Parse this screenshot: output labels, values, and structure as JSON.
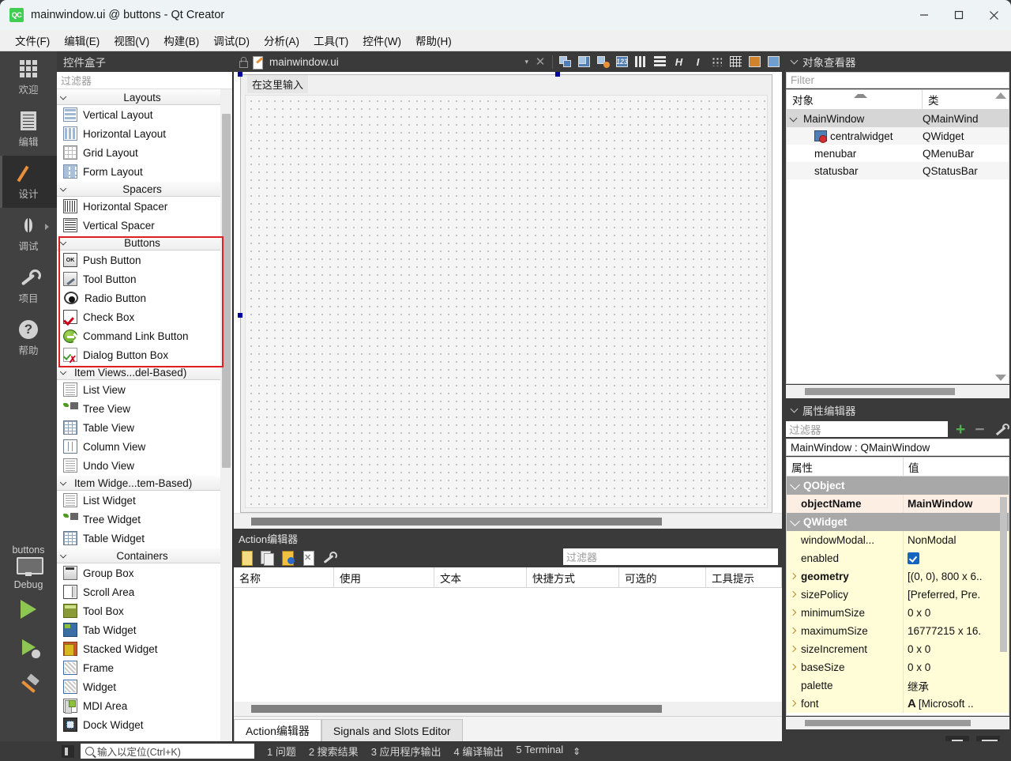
{
  "titlebar": {
    "icon": "qt-logo-icon",
    "title": "mainwindow.ui @ buttons - Qt Creator",
    "minimize": "—",
    "maximize": "□",
    "close": "✕"
  },
  "menubar": {
    "items": [
      "文件(F)",
      "编辑(E)",
      "视图(V)",
      "构建(B)",
      "调试(D)",
      "分析(A)",
      "工具(T)",
      "控件(W)",
      "帮助(H)"
    ]
  },
  "modebar": {
    "modes": [
      {
        "label": "欢迎",
        "icon": "grid-icon",
        "active": false
      },
      {
        "label": "编辑",
        "icon": "document-icon",
        "active": false
      },
      {
        "label": "设计",
        "icon": "pencil-icon",
        "active": true
      },
      {
        "label": "调试",
        "icon": "bug-icon",
        "active": false
      },
      {
        "label": "项目",
        "icon": "wrench-icon",
        "active": false
      },
      {
        "label": "帮助",
        "icon": "question-icon",
        "active": false
      }
    ],
    "kit_name": "buttons",
    "kit_config": "Debug",
    "run_label": "run-button",
    "debug_label": "start-debugging-button",
    "build_label": "build-button"
  },
  "widgetbox": {
    "header": "控件盒子",
    "filter_placeholder": "过滤器",
    "groups": [
      {
        "title": "Layouts",
        "centered": true,
        "highlighted": false,
        "items": [
          {
            "label": "Vertical Layout",
            "icon": "vertical-layout-icon",
            "cls": "ic-vlayout"
          },
          {
            "label": "Horizontal Layout",
            "icon": "horizontal-layout-icon",
            "cls": "ic-hlayout"
          },
          {
            "label": "Grid Layout",
            "icon": "grid-layout-icon",
            "cls": "ic-grid"
          },
          {
            "label": "Form Layout",
            "icon": "form-layout-icon",
            "cls": "ic-form"
          }
        ]
      },
      {
        "title": "Spacers",
        "centered": true,
        "highlighted": false,
        "items": [
          {
            "label": "Horizontal Spacer",
            "icon": "horizontal-spacer-icon",
            "cls": "ic-hspacer"
          },
          {
            "label": "Vertical Spacer",
            "icon": "vertical-spacer-icon",
            "cls": "ic-vspacer"
          }
        ]
      },
      {
        "title": "Buttons",
        "centered": true,
        "highlighted": true,
        "items": [
          {
            "label": "Push Button",
            "icon": "push-button-icon",
            "cls": "ic-push",
            "text": "OK"
          },
          {
            "label": "Tool Button",
            "icon": "tool-button-icon",
            "cls": "ic-tool"
          },
          {
            "label": "Radio Button",
            "icon": "radio-button-icon",
            "cls": "ic-radio"
          },
          {
            "label": "Check Box",
            "icon": "check-box-icon",
            "cls": "ic-check"
          },
          {
            "label": "Command Link Button",
            "icon": "command-link-button-icon",
            "cls": "ic-cmd"
          },
          {
            "label": "Dialog Button Box",
            "icon": "dialog-button-box-icon",
            "cls": "ic-dlg"
          }
        ]
      },
      {
        "title": "Item Views...del-Based)",
        "centered": false,
        "highlighted": false,
        "items": [
          {
            "label": "List View",
            "icon": "list-view-icon",
            "cls": "ic-listv"
          },
          {
            "label": "Tree View",
            "icon": "tree-view-icon",
            "cls": "ic-treev"
          },
          {
            "label": "Table View",
            "icon": "table-view-icon",
            "cls": "ic-tablev"
          },
          {
            "label": "Column View",
            "icon": "column-view-icon",
            "cls": "ic-colv"
          },
          {
            "label": "Undo View",
            "icon": "undo-view-icon",
            "cls": "ic-listv"
          }
        ]
      },
      {
        "title": "Item Widge...tem-Based)",
        "centered": false,
        "highlighted": false,
        "items": [
          {
            "label": "List Widget",
            "icon": "list-widget-icon",
            "cls": "ic-listv"
          },
          {
            "label": "Tree Widget",
            "icon": "tree-widget-icon",
            "cls": "ic-treev"
          },
          {
            "label": "Table Widget",
            "icon": "table-widget-icon",
            "cls": "ic-tablev"
          }
        ]
      },
      {
        "title": "Containers",
        "centered": true,
        "highlighted": false,
        "items": [
          {
            "label": "Group Box",
            "icon": "group-box-icon",
            "cls": "ic-group"
          },
          {
            "label": "Scroll Area",
            "icon": "scroll-area-icon",
            "cls": "ic-scroll"
          },
          {
            "label": "Tool Box",
            "icon": "tool-box-icon",
            "cls": "ic-toolbox"
          },
          {
            "label": "Tab Widget",
            "icon": "tab-widget-icon",
            "cls": "ic-tab"
          },
          {
            "label": "Stacked Widget",
            "icon": "stacked-widget-icon",
            "cls": "ic-stacked"
          },
          {
            "label": "Frame",
            "icon": "frame-icon",
            "cls": "ic-frame"
          },
          {
            "label": "Widget",
            "icon": "widget-icon",
            "cls": "ic-frame"
          },
          {
            "label": "MDI Area",
            "icon": "mdi-area-icon",
            "cls": "ic-mdi"
          },
          {
            "label": "Dock Widget",
            "icon": "dock-widget-icon",
            "cls": "ic-dock"
          }
        ]
      }
    ]
  },
  "editor": {
    "filename": "mainwindow.ui",
    "lock_icon": "unlocked-icon",
    "file_icon": "ui-file-icon",
    "dropdown_icon": "chevron-down-icon",
    "close_icon": "close-icon",
    "tools": [
      "edit-widgets-icon",
      "edit-signals-slots-icon",
      "edit-buddies-icon",
      "edit-tab-order-icon",
      "layout-horizontally-icon",
      "layout-vertically-icon",
      "layout-splitter-horizontal-icon",
      "layout-splitter-vertical-icon",
      "layout-form-icon",
      "layout-grid-icon",
      "break-layout-icon",
      "adjust-size-icon"
    ]
  },
  "canvas": {
    "form_menubar_hint": "在这里输入"
  },
  "action_editor": {
    "title": "Action编辑器",
    "toolbar_icons": [
      "new-action-icon",
      "copy-icon",
      "edit-action-icon",
      "delete-action-icon",
      "configure-icon"
    ],
    "filter_placeholder": "过滤器",
    "columns": [
      "名称",
      "使用",
      "文本",
      "快捷方式",
      "可选的",
      "工具提示"
    ],
    "rows": [],
    "tabs": [
      {
        "label": "Action编辑器",
        "active": true
      },
      {
        "label": "Signals and Slots Editor",
        "active": false
      }
    ]
  },
  "object_inspector": {
    "title": "对象查看器",
    "filter_placeholder": "Filter",
    "columns": [
      "对象",
      "类"
    ],
    "rows": [
      {
        "name": "MainWindow",
        "cls": "QMainWind",
        "indent": 0,
        "expandable": true,
        "selected": true,
        "icon": null
      },
      {
        "name": "centralwidget",
        "cls": "QWidget",
        "indent": 2,
        "expandable": false,
        "selected": false,
        "icon": "central-widget-icon"
      },
      {
        "name": "menubar",
        "cls": "QMenuBar",
        "indent": 2,
        "expandable": false,
        "selected": false,
        "icon": null
      },
      {
        "name": "statusbar",
        "cls": "QStatusBar",
        "indent": 2,
        "expandable": false,
        "selected": false,
        "icon": null
      }
    ]
  },
  "property_editor": {
    "title": "属性编辑器",
    "filter_placeholder": "过滤器",
    "add_icon": "plus-icon",
    "remove_icon": "minus-icon",
    "config_icon": "wrench-icon",
    "object_line": "MainWindow : QMainWindow",
    "columns": [
      "属性",
      "值"
    ],
    "rows": [
      {
        "kind": "group",
        "name": "QObject",
        "value": ""
      },
      {
        "kind": "obj",
        "name": "objectName",
        "value": "MainWindow",
        "bold": true
      },
      {
        "kind": "group",
        "name": "QWidget",
        "value": ""
      },
      {
        "kind": "yel",
        "name": "windowModal...",
        "value": "NonModal"
      },
      {
        "kind": "yel",
        "name": "enabled",
        "value": "",
        "checkbox": true
      },
      {
        "kind": "yel",
        "name": "geometry",
        "value": "[(0, 0), 800 x 6..",
        "expandable": true,
        "bold": true
      },
      {
        "kind": "yel",
        "name": "sizePolicy",
        "value": "[Preferred, Pre.",
        "expandable": true
      },
      {
        "kind": "yel",
        "name": "minimumSize",
        "value": "0 x 0",
        "expandable": true
      },
      {
        "kind": "yel",
        "name": "maximumSize",
        "value": "16777215 x 16.",
        "expandable": true
      },
      {
        "kind": "yel",
        "name": "sizeIncrement",
        "value": "0 x 0",
        "expandable": true
      },
      {
        "kind": "yel",
        "name": "baseSize",
        "value": "0 x 0",
        "expandable": true
      },
      {
        "kind": "yel",
        "name": "palette",
        "value": "继承"
      },
      {
        "kind": "yel",
        "name": "font",
        "value": "[Microsoft ..",
        "expandable": true,
        "fonticon": true
      }
    ]
  },
  "right_bottom": {
    "split_icon": "split-view-icon",
    "sidebar_icon": "toggle-sidebar-icon"
  },
  "statusbar": {
    "toggle_icon": "toggle-panel-icon",
    "locator_placeholder": "输入以定位(Ctrl+K)",
    "search_icon": "search-icon",
    "outputs": [
      "1 问题",
      "2 搜索结果",
      "3 应用程序输出",
      "4 编译输出",
      "5 Terminal"
    ],
    "resize_icon": "⇕"
  },
  "colors": {
    "dark_chrome": "#3a3a3a",
    "mode_bar": "#414141",
    "accent_green": "#41cd52",
    "highlight_red": "#e02020",
    "selection_gray": "#d6d6d6",
    "property_yellow": "#fffdd8",
    "property_pink": "#fdeee4",
    "group_gray": "#a8a8a8",
    "checkbox_blue": "#1565c0"
  }
}
